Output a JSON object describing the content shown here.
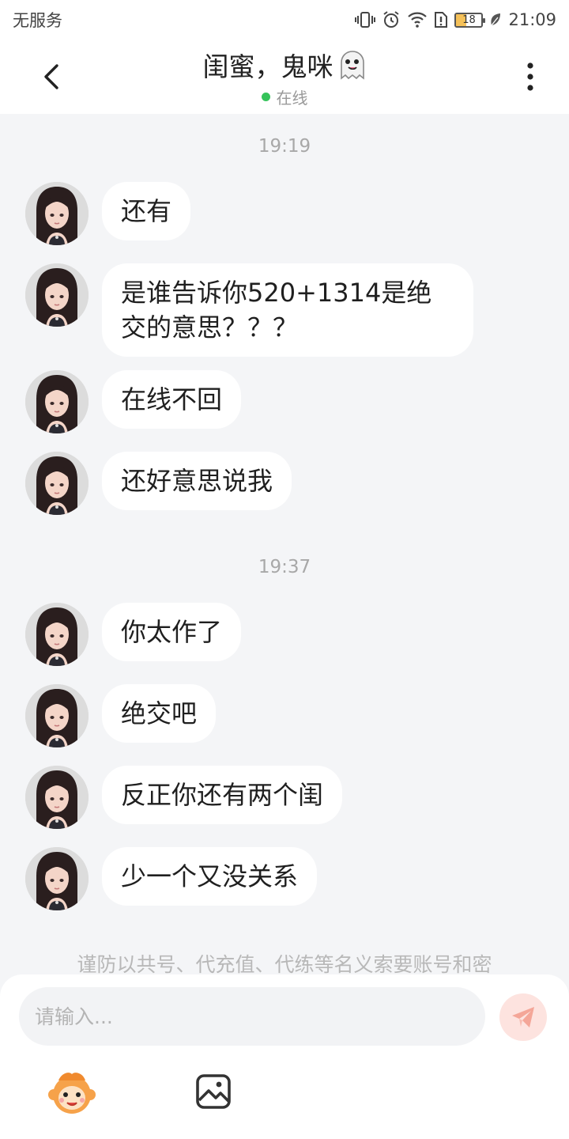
{
  "status_bar": {
    "carrier": "无服务",
    "battery": "18",
    "time": "21:09"
  },
  "header": {
    "title": "闺蜜，鬼咪",
    "title_icon": "ghost-emoji",
    "status": "在线"
  },
  "chat": {
    "groups": [
      {
        "time": "19:19",
        "messages": [
          "还有",
          "是谁告诉你520+1314是绝交的意思？？？",
          "在线不回",
          "还好意思说我"
        ]
      },
      {
        "time": "19:37",
        "messages": [
          "你太作了",
          "绝交吧",
          "反正你还有两个闺",
          "少一个又没关系"
        ]
      }
    ],
    "warning": "谨防以共号、代充值、代练等名义索要账号和密"
  },
  "composer": {
    "placeholder": "请输入..."
  },
  "colors": {
    "online": "#35c35a",
    "send_bg": "#fde3df",
    "send_icon": "#f4a698",
    "background": "#f4f5f7"
  }
}
